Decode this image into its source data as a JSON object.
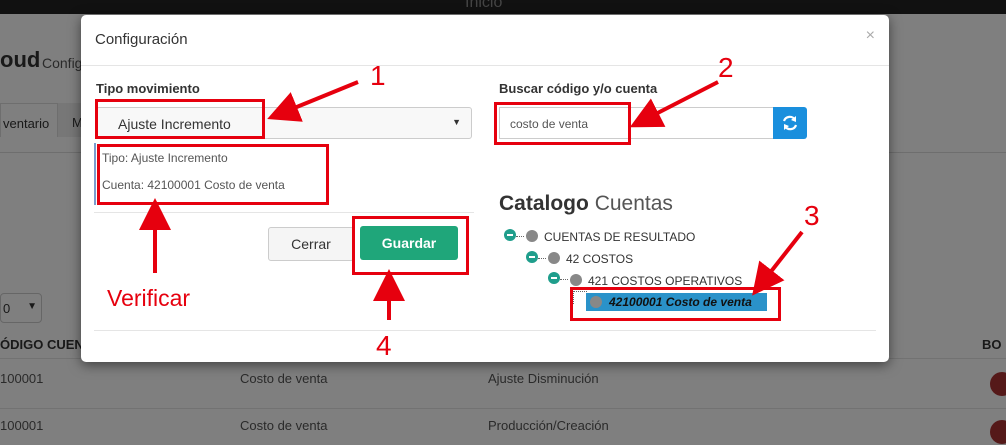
{
  "background": {
    "topbar_title": "Inicio",
    "brand": "oud",
    "brand_sub": "Config",
    "tabs": [
      "ventario",
      "M"
    ],
    "page_size_value": "0",
    "table": {
      "headers": [
        "ÓDIGO CUENT",
        "BO"
      ],
      "rows": [
        {
          "code": "100001",
          "name": "Costo de venta",
          "tipo": "Ajuste Disminución"
        },
        {
          "code": "100001",
          "name": "Costo de venta",
          "tipo": "Producción/Creación"
        }
      ]
    }
  },
  "modal": {
    "title": "Configuración",
    "close_icon": "×",
    "tipo_movimiento": {
      "label": "Tipo movimiento",
      "selected": "Ajuste Incremento"
    },
    "info": {
      "tipo": "Tipo: Ajuste Incremento",
      "cuenta": "Cuenta: 42100001 Costo de venta"
    },
    "buttons": {
      "cerrar": "Cerrar",
      "guardar": "Guardar"
    },
    "search": {
      "label": "Buscar código y/o cuenta",
      "value": "costo de venta",
      "button_icon": "refresh-icon"
    },
    "catalog": {
      "title_bold": "Catalogo",
      "title_rest": "Cuentas",
      "tree": [
        {
          "label": "CUENTAS DE RESULTADO"
        },
        {
          "label": "42 COSTOS"
        },
        {
          "label": "421 COSTOS OPERATIVOS"
        },
        {
          "label": "42100001 Costo de venta",
          "selected": true
        }
      ]
    }
  },
  "annotations": {
    "numbers": [
      "1",
      "2",
      "3",
      "4"
    ],
    "verificar": "Verificar",
    "color": "#e6000e"
  },
  "colors": {
    "guardar": "#1fa67a",
    "search_button": "#1a8fdd",
    "tree_toggle": "#1f9e8c",
    "selected_node": "#2a92c9"
  }
}
